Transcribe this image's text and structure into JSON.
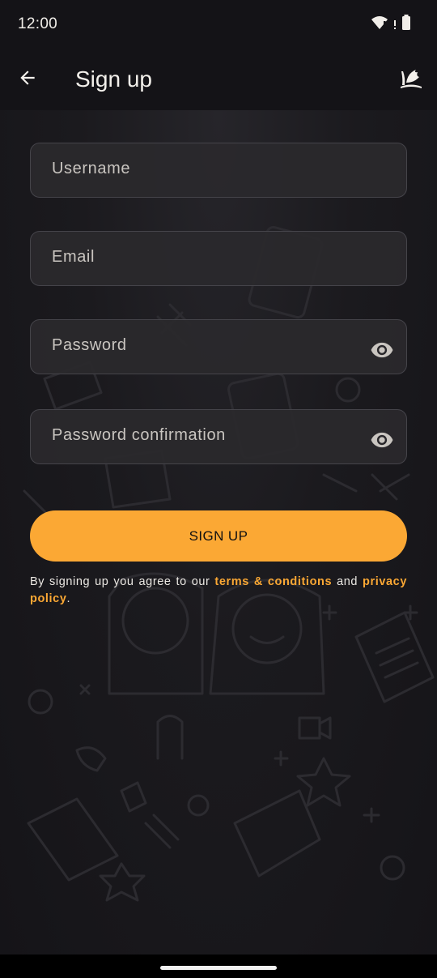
{
  "status_bar": {
    "time": "12:00",
    "icons": [
      "wifi-icon",
      "signal-icon",
      "battery-icon"
    ]
  },
  "app_bar": {
    "title": "Sign up",
    "back_icon": "arrow-left-icon",
    "logo_icon": "app-logo-icon"
  },
  "form": {
    "username_label": "Username",
    "email_label": "Email",
    "password_label": "Password",
    "password_confirm_label": "Password confirmation",
    "visibility_icon": "eye-icon"
  },
  "signup_button": {
    "label": "SIGN UP"
  },
  "terms": {
    "prefix": "By signing up you agree to our ",
    "terms_link": "terms & conditions",
    "middle": " and ",
    "privacy_link": "privacy policy",
    "suffix": "."
  },
  "colors": {
    "accent": "#FBA834",
    "background": "#151418",
    "field_background": "#2A292D",
    "field_border": "#45444A",
    "text": "#ECE9E4"
  }
}
